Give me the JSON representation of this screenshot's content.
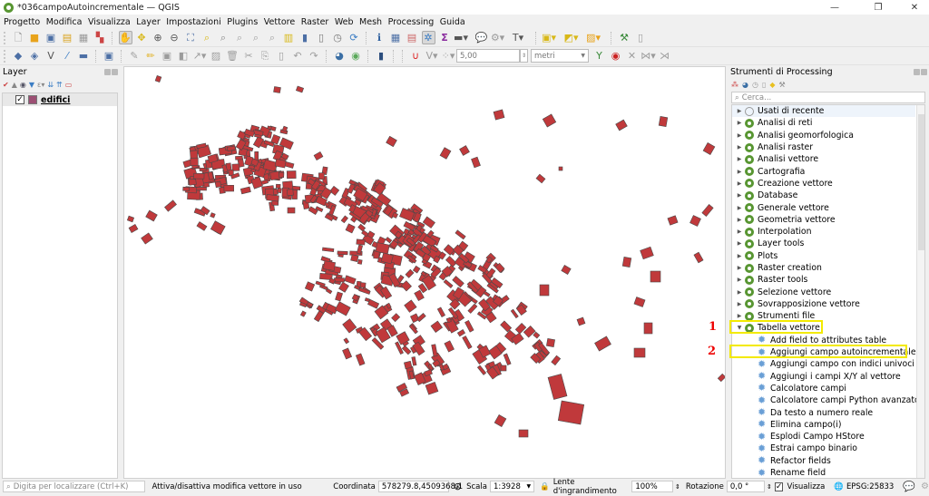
{
  "window": {
    "title": "*036campoAutoincrementale — QGIS",
    "minimize": "—",
    "maximize": "❐",
    "close": "✕"
  },
  "menu": [
    "Progetto",
    "Modifica",
    "Visualizza",
    "Layer",
    "Impostazioni",
    "Plugins",
    "Vettore",
    "Raster",
    "Web",
    "Mesh",
    "Processing",
    "Guida"
  ],
  "toolbar": {
    "snap_tolerance": "5,00",
    "snap_units": "metri"
  },
  "layers_panel": {
    "title": "Layer",
    "layers": [
      {
        "name": "edifici",
        "visible": true,
        "color": "#9c4f73"
      }
    ]
  },
  "map": {
    "feature_fill": "#c0393b",
    "feature_stroke": "#4a4a4a"
  },
  "processing": {
    "title": "Strumenti di Processing",
    "search_placeholder": "Cerca...",
    "groups": [
      "Usati di recente",
      "Analisi di reti",
      "Analisi geomorfologica",
      "Analisi raster",
      "Analisi vettore",
      "Cartografia",
      "Creazione vettore",
      "Database",
      "Generale vettore",
      "Geometria vettore",
      "Interpolation",
      "Layer tools",
      "Plots",
      "Raster creation",
      "Raster tools",
      "Selezione vettore",
      "Sovrapposizione vettore",
      "Strumenti file",
      "Tabella vettore"
    ],
    "expanded_group": "Tabella vettore",
    "tools": [
      "Add field to attributes table",
      "Aggiungi campo autoincrementale",
      "Aggiungi campo con indici univoci",
      "Aggiungi i campi X/Y al vettore",
      "Calcolatore campi",
      "Calcolatore campi Python avanzato",
      "Da testo a numero reale",
      "Elimina campo(i)",
      "Esplodi Campo HStore",
      "Estrai campo binario",
      "Refactor fields",
      "Rename field"
    ]
  },
  "annotations": {
    "one": "1",
    "two": "2",
    "highlight_color": "#f3ea00"
  },
  "statusbar": {
    "locator_placeholder": "Digita per localizzare (Ctrl+K)",
    "message": "Attiva/disattiva modifica vettore in uso",
    "coord_label": "Coordinata",
    "coord_value": "578279.8,4509368.1",
    "scale_label": "Scala",
    "scale_value": "1:3928",
    "magnifier_label": "Lente d'ingrandimento",
    "magnifier_value": "100%",
    "rotation_label": "Rotazione",
    "rotation_value": "0,0 °",
    "render_label": "Visualizza",
    "crs": "EPSG:25833"
  }
}
